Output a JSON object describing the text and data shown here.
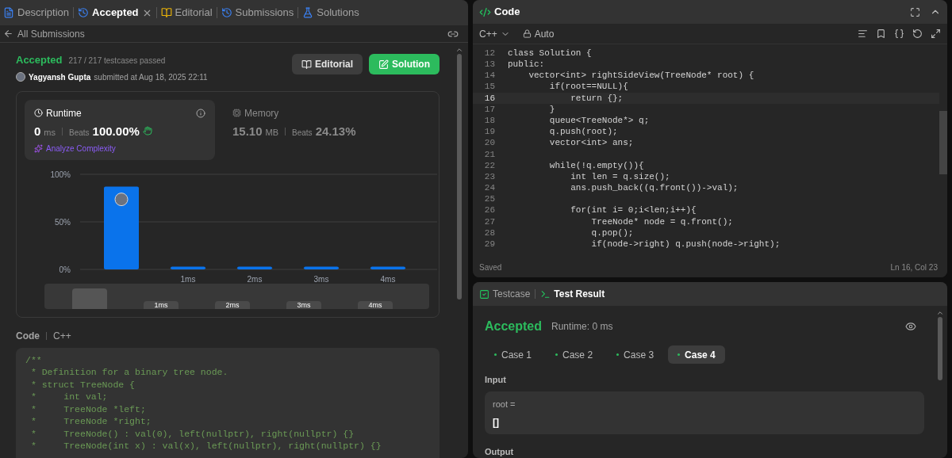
{
  "left_tabs": [
    {
      "label": "Description",
      "selected": false
    },
    {
      "label": "Accepted",
      "selected": true
    },
    {
      "label": "Editorial",
      "selected": false
    },
    {
      "label": "Submissions",
      "selected": false
    },
    {
      "label": "Solutions",
      "selected": false
    }
  ],
  "back_link": "All Submissions",
  "submission": {
    "status": "Accepted",
    "testcases": "217 / 217 testcases passed",
    "author": "Yagyansh Gupta",
    "submitted": "submitted at Aug 18, 2025 22:11",
    "buttons": [
      {
        "label": "Editorial",
        "kind": "secondary"
      },
      {
        "label": "Solution",
        "kind": "primary"
      }
    ]
  },
  "stats": [
    {
      "title": "Runtime",
      "selected": true,
      "value": "0",
      "unit": "ms",
      "beats_label": "Beats",
      "beats": "100.00%",
      "link": "Analyze Complexity"
    },
    {
      "title": "Memory",
      "selected": false,
      "value": "15.10",
      "unit": "MB",
      "beats_label": "Beats",
      "beats": "24.13%"
    }
  ],
  "chart_data": {
    "type": "bar",
    "categories": [
      null,
      "1ms",
      "2ms",
      "3ms",
      "4ms"
    ],
    "values": [
      87,
      3,
      3,
      3,
      3
    ],
    "ylim": [
      0,
      100
    ],
    "yticks": [
      {
        "value": 0,
        "label": "0%"
      },
      {
        "value": 50,
        "label": "50%"
      },
      {
        "value": 100,
        "label": "100%"
      }
    ]
  },
  "minimap": {
    "level": 0.1,
    "labels": [
      "1ms",
      "2ms",
      "3ms",
      "4ms"
    ]
  },
  "code_section": {
    "title": "Code",
    "language": "C++",
    "lines": [
      "/**",
      " * Definition for a binary tree node.",
      " * struct TreeNode {",
      " *     int val;",
      " *     TreeNode *left;",
      " *     TreeNode *right;",
      " *     TreeNode() : val(0), left(nullptr), right(nullptr) {}",
      " *     TreeNode(int x) : val(x), left(nullptr), right(nullptr) {}"
    ]
  },
  "editor": {
    "title": "Code",
    "language": "C++",
    "mode": "Auto",
    "status": "Saved",
    "cursor": "Ln 16, Col 23",
    "lines": [
      {
        "num": "12",
        "selected": false,
        "text": "class Solution {"
      },
      {
        "num": "13",
        "selected": false,
        "text": "public:"
      },
      {
        "num": "14",
        "selected": false,
        "text": "    vector<int> rightSideView(TreeNode* root) {"
      },
      {
        "num": "15",
        "selected": false,
        "text": "        if(root==NULL){"
      },
      {
        "num": "16",
        "selected": true,
        "text": "            return {};"
      },
      {
        "num": "17",
        "selected": false,
        "text": "        }"
      },
      {
        "num": "18",
        "selected": false,
        "text": "        queue<TreeNode*> q;"
      },
      {
        "num": "19",
        "selected": false,
        "text": "        q.push(root);"
      },
      {
        "num": "20",
        "selected": false,
        "text": "        vector<int> ans;"
      },
      {
        "num": "21",
        "selected": false
      },
      {
        "num": "22",
        "selected": false,
        "text": "        while(!q.empty()){"
      },
      {
        "num": "23",
        "selected": false,
        "text": "            int len = q.size();"
      },
      {
        "num": "24",
        "selected": false,
        "text": "            ans.push_back((q.front())->val);"
      },
      {
        "num": "25",
        "selected": false
      },
      {
        "num": "26",
        "selected": false,
        "text": "            for(int i= 0;i<len;i++){"
      },
      {
        "num": "27",
        "selected": false,
        "text": "                TreeNode* node = q.front();"
      },
      {
        "num": "28",
        "selected": false,
        "text": "                q.pop();"
      },
      {
        "num": "29",
        "selected": false,
        "text": "                if(node->right) q.push(node->right);"
      }
    ]
  },
  "bottom_tabs": [
    {
      "label": "Testcase",
      "selected": false
    },
    {
      "label": "Test Result",
      "selected": true
    }
  ],
  "result": {
    "status": "Accepted",
    "runtime": "Runtime: 0 ms",
    "cases": [
      {
        "label": "Case 1",
        "selected": false
      },
      {
        "label": "Case 2",
        "selected": false
      },
      {
        "label": "Case 3",
        "selected": false
      },
      {
        "label": "Case 4",
        "selected": true
      }
    ],
    "input_label": "Input",
    "input_name": "root =",
    "input_value": "[]",
    "output_label": "Output"
  }
}
